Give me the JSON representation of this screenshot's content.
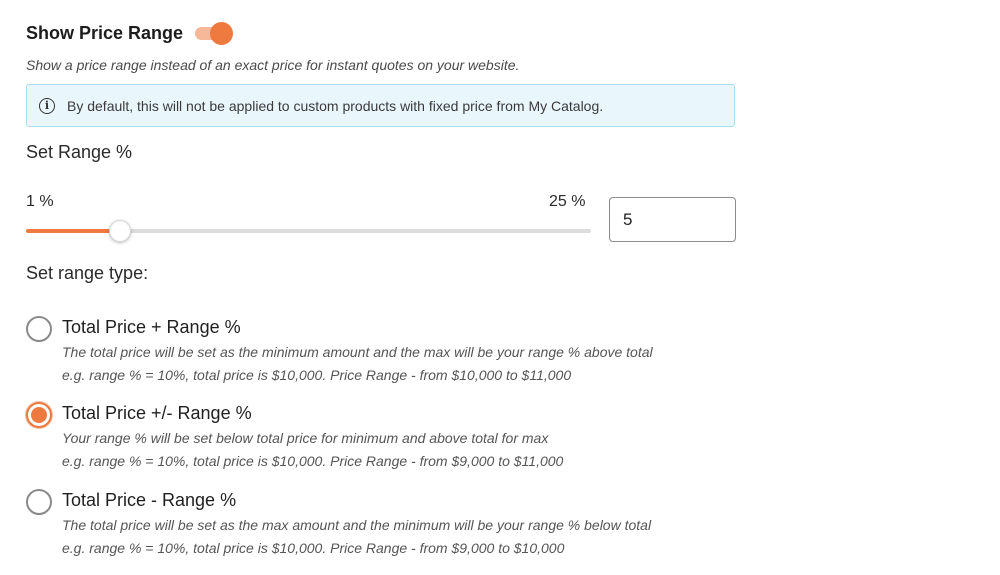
{
  "header": {
    "title": "Show Price Range",
    "toggle_on": true,
    "subtitle": "Show a price range instead of an exact price for instant quotes on your website."
  },
  "info": {
    "icon": "info-icon",
    "text": "By default, this will not be applied to custom products with fixed price from My Catalog."
  },
  "range": {
    "label": "Set Range %",
    "min_label": "1 %",
    "max_label": "25 %",
    "min": 1,
    "max": 25,
    "value": 5,
    "input_value": "5"
  },
  "range_type": {
    "label": "Set range type:",
    "options": [
      {
        "label": "Total Price + Range %",
        "checked": false,
        "desc1": "The total price will be set as the minimum amount and the max will be your range % above total",
        "desc2": "e.g. range % = 10%, total price is $10,000. Price Range - from $10,000 to $11,000"
      },
      {
        "label": "Total Price +/- Range %",
        "checked": true,
        "desc1": "Your range % will be set below total price for minimum and above total for max",
        "desc2": "e.g. range % = 10%, total price is $10,000. Price Range - from $9,000 to $11,000"
      },
      {
        "label": "Total Price - Range %",
        "checked": false,
        "desc1": "The total price will be set as the max amount and the minimum will be your range % below total",
        "desc2": "e.g. range % = 10%, total price is $10,000. Price Range - from $9,000 to $10,000"
      }
    ]
  },
  "colors": {
    "accent": "#ee7a3f",
    "info_bg": "#e9f7fd",
    "info_border": "#aadcef"
  }
}
